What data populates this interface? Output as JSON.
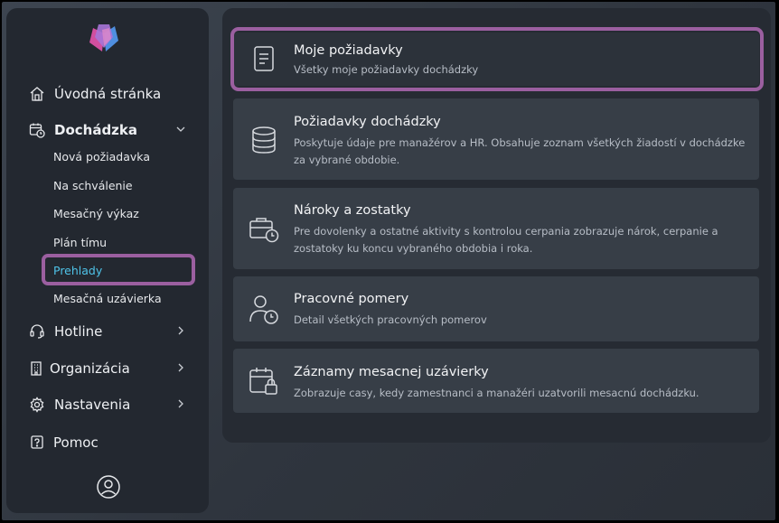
{
  "sidebar": {
    "items": [
      {
        "label": "Úvodná stránka",
        "icon": "home-icon"
      },
      {
        "label": "Dochádzka",
        "icon": "calendar-clock-icon"
      },
      {
        "label": "Hotline",
        "icon": "headset-icon"
      },
      {
        "label": "Organizácia",
        "icon": "building-icon"
      },
      {
        "label": "Nastavenia",
        "icon": "gear-icon"
      },
      {
        "label": "Pomoc",
        "icon": "help-icon"
      }
    ],
    "submenu": [
      {
        "label": "Nová požiadavka"
      },
      {
        "label": "Na schválenie"
      },
      {
        "label": "Mesačný výkaz"
      },
      {
        "label": "Plán tímu"
      },
      {
        "label": "Prehlady",
        "active": true
      },
      {
        "label": "Mesačná uzávierka"
      }
    ]
  },
  "cards": [
    {
      "title": "Moje požiadavky",
      "description": "Všetky moje požiadavky dochádzky",
      "icon": "document-icon"
    },
    {
      "title": "Požiadavky dochádzky",
      "description": "Poskytuje údaje pre manažérov a HR. Obsahuje zoznam všetkých žiadostí v dochádzke za vybrané obdobie.",
      "icon": "database-icon"
    },
    {
      "title": "Nároky a zostatky",
      "description": "Pre dovolenky a ostatné aktivity s kontrolou cerpania zobrazuje nárok, cerpanie a zostatoky ku koncu vybraného obdobia i roka.",
      "icon": "briefcase-clock-icon"
    },
    {
      "title": "Pracovné pomery",
      "description": "Detail všetkých pracovných pomerov",
      "icon": "person-clock-icon"
    },
    {
      "title": "Záznamy mesacnej uzávierky",
      "description": "Zobrazuje casy, kedy zamestnanci a manažéri uzatvorili mesacnú dochádzku.",
      "icon": "calendar-lock-icon"
    }
  ],
  "colors": {
    "accent": "#4fc3e8",
    "highlight": "#9b5fa0"
  }
}
